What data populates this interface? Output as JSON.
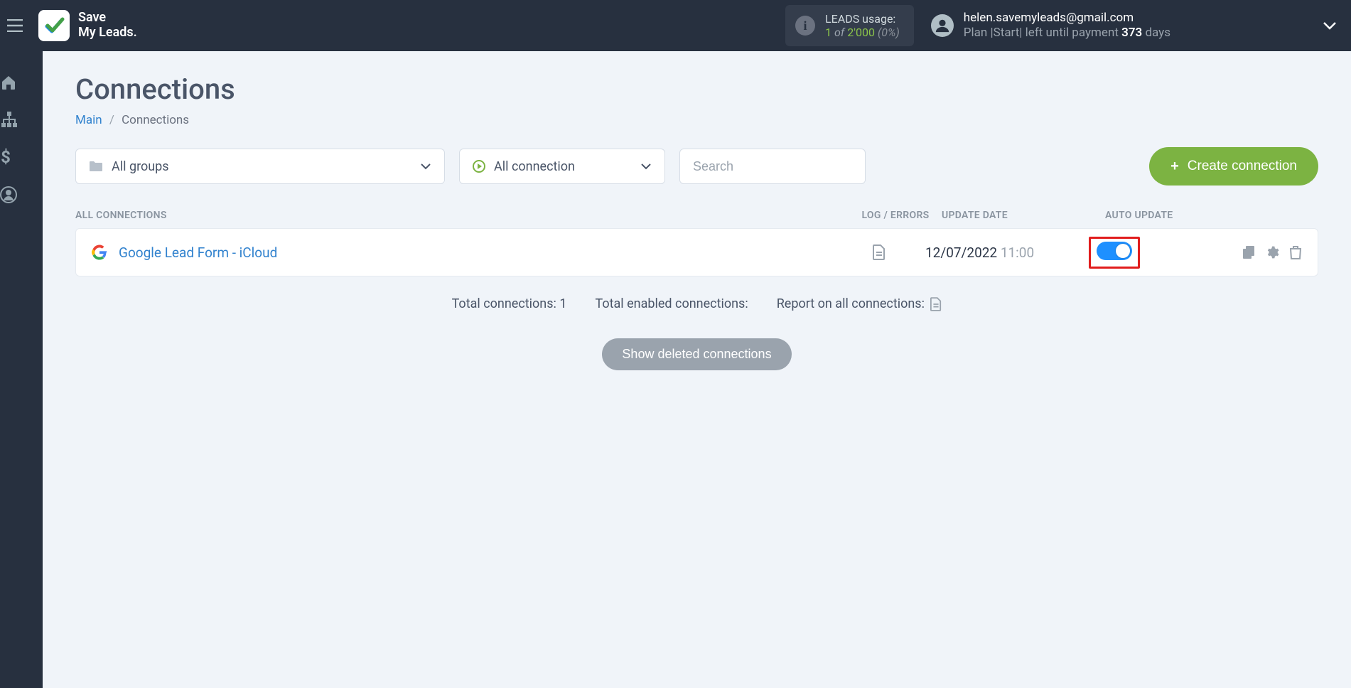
{
  "brand": {
    "line1": "Save",
    "line2": "My Leads."
  },
  "usage": {
    "label": "LEADS usage:",
    "count": "1",
    "of": "of",
    "limit": "2'000",
    "pct": "(0%)"
  },
  "account": {
    "email": "helen.savemyleads@gmail.com",
    "plan_prefix": "Plan |Start| left until payment ",
    "days": "373",
    "days_suffix": " days"
  },
  "page": {
    "title": "Connections",
    "breadcrumb_main": "Main",
    "breadcrumb_current": "Connections"
  },
  "filters": {
    "groups": "All groups",
    "status": "All connection",
    "search_placeholder": "Search"
  },
  "buttons": {
    "create": "Create connection",
    "show_deleted": "Show deleted connections"
  },
  "table": {
    "head_name": "ALL CONNECTIONS",
    "head_log": "LOG / ERRORS",
    "head_date": "UPDATE DATE",
    "head_auto": "AUTO UPDATE",
    "rows": [
      {
        "name": "Google Lead Form - iCloud",
        "date": "12/07/2022",
        "time": "11:00"
      }
    ]
  },
  "summary": {
    "total_label": "Total connections: ",
    "total_value": "1",
    "enabled_label": "Total enabled connections:",
    "report_label": "Report on all connections:"
  }
}
